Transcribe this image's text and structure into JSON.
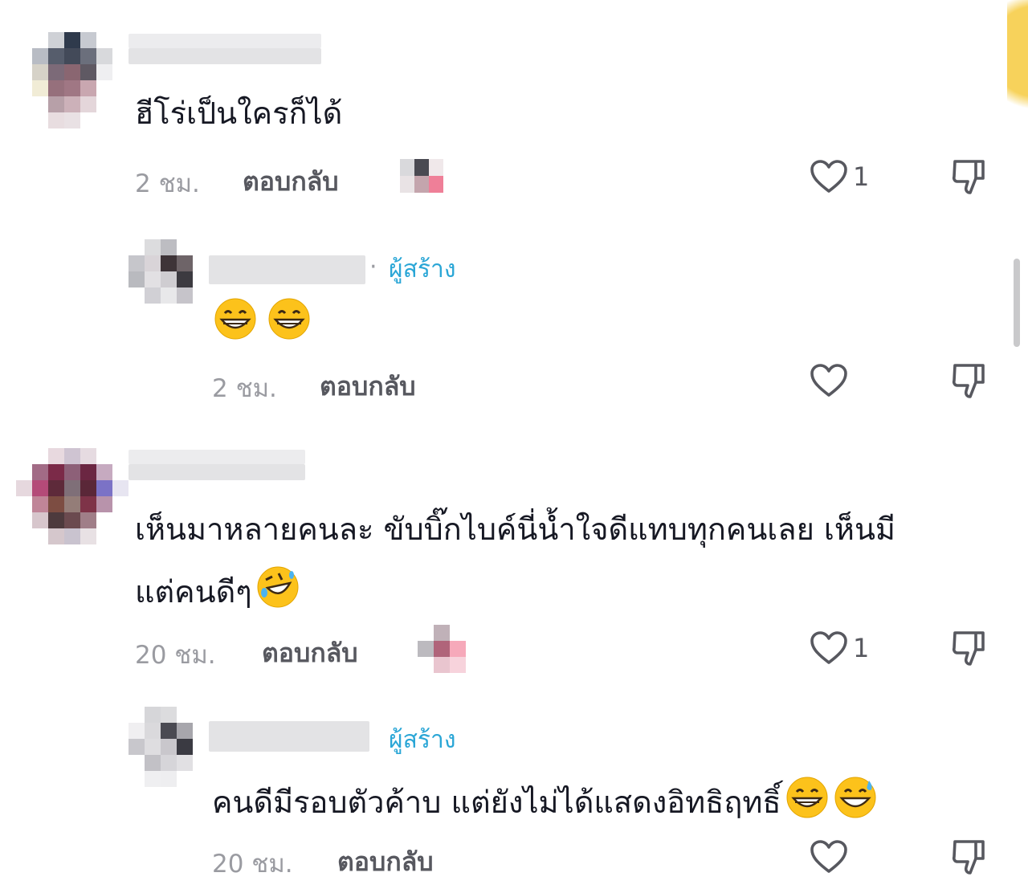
{
  "comments": [
    {
      "text": "ฮีโร่เป็นใครก็ได้",
      "time": "2 ชม.",
      "reply_label": "ตอบกลับ",
      "likes": "1",
      "replies": [
        {
          "creator_label": "ผู้สร้าง",
          "separator": "·",
          "time": "2 ชม.",
          "reply_label": "ตอบกลับ"
        }
      ]
    },
    {
      "text_line1": "เห็นมาหลายคนละ ขับบิ๊กไบค์นี่น้ำใจดีแทบทุกคนเลย เห็นมี",
      "text_line2": "แต่คนดีๆ",
      "time": "20 ชม.",
      "reply_label": "ตอบกลับ",
      "likes": "1",
      "replies": [
        {
          "creator_label": "ผู้สร้าง",
          "text": "คนดีมีรอบตัวค้าบ แต่ยังไม่ได้แสดงอิทธิฤทธิ์",
          "time": "20 ชม.",
          "reply_label": "ตอบกลับ"
        }
      ]
    }
  ],
  "icons": [
    "heart-icon",
    "dislike-icon",
    "grin-emoji",
    "rofl-emoji",
    "sweat-smile-emoji"
  ],
  "colors": {
    "creator": "#2aa6d6",
    "meta": "#9a9ba1",
    "text": "#161823"
  }
}
